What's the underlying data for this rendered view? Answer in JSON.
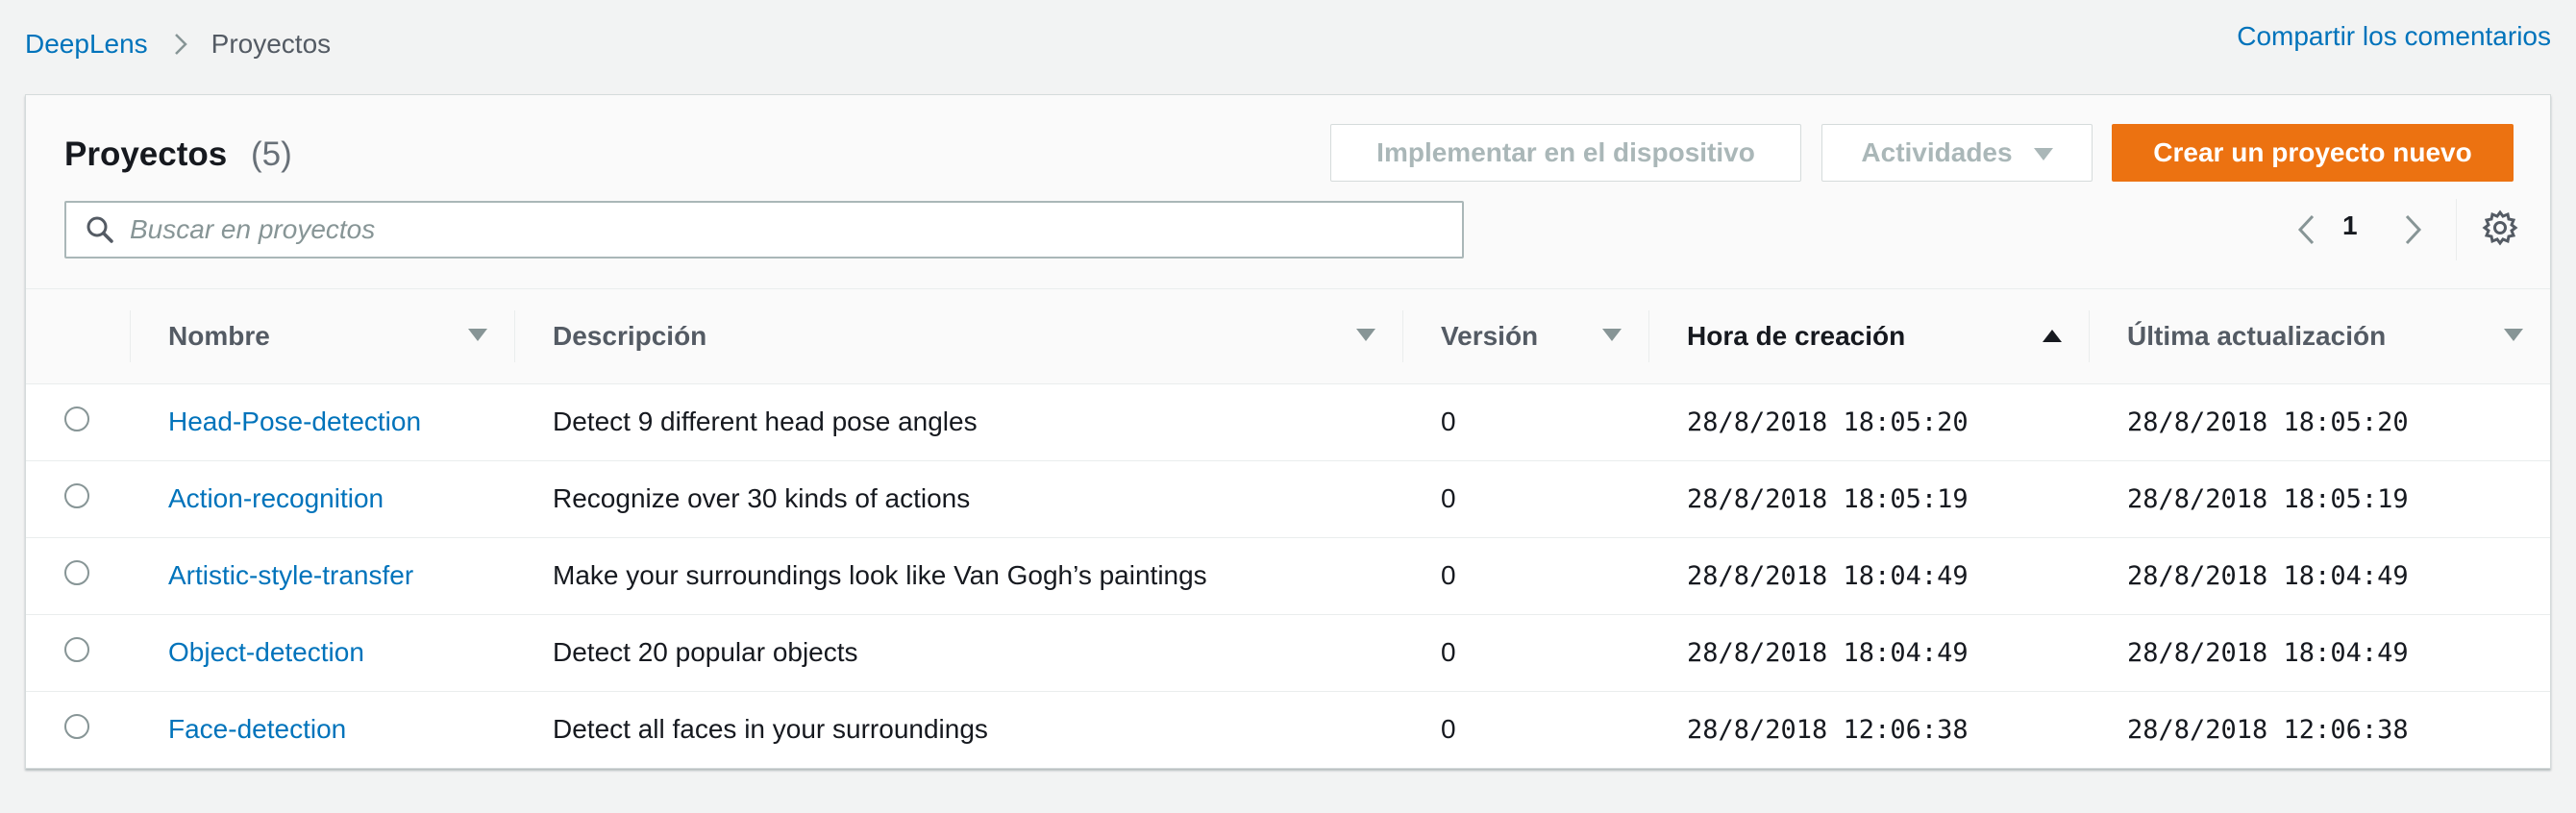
{
  "breadcrumb": {
    "root": "DeepLens",
    "current": "Proyectos"
  },
  "feedback_link": "Compartir los comentarios",
  "panel": {
    "title": "Proyectos",
    "count": "(5)",
    "buttons": {
      "deploy": "Implementar en el dispositivo",
      "actions": "Actividades",
      "create": "Crear un proyecto nuevo"
    },
    "search_placeholder": "Buscar en proyectos",
    "page": "1"
  },
  "table": {
    "columns": {
      "name": "Nombre",
      "description": "Descripción",
      "version": "Versión",
      "created": "Hora de creación",
      "updated": "Última actualización"
    },
    "rows": [
      {
        "name": "Head-Pose-detection",
        "description": "Detect 9 different head pose angles",
        "version": "0",
        "created": "28/8/2018 18:05:20",
        "updated": "28/8/2018 18:05:20"
      },
      {
        "name": "Action-recognition",
        "description": "Recognize over 30 kinds of actions",
        "version": "0",
        "created": "28/8/2018 18:05:19",
        "updated": "28/8/2018 18:05:19"
      },
      {
        "name": "Artistic-style-transfer",
        "description": "Make your surroundings look like Van Gogh’s paintings",
        "version": "0",
        "created": "28/8/2018 18:04:49",
        "updated": "28/8/2018 18:04:49"
      },
      {
        "name": "Object-detection",
        "description": "Detect 20 popular objects",
        "version": "0",
        "created": "28/8/2018 18:04:49",
        "updated": "28/8/2018 18:04:49"
      },
      {
        "name": "Face-detection",
        "description": "Detect all faces in your surroundings",
        "version": "0",
        "created": "28/8/2018 12:06:38",
        "updated": "28/8/2018 12:06:38"
      }
    ]
  },
  "colors": {
    "link": "#0073bb",
    "primary_button": "#ec7211",
    "page_background": "#f2f3f3"
  }
}
